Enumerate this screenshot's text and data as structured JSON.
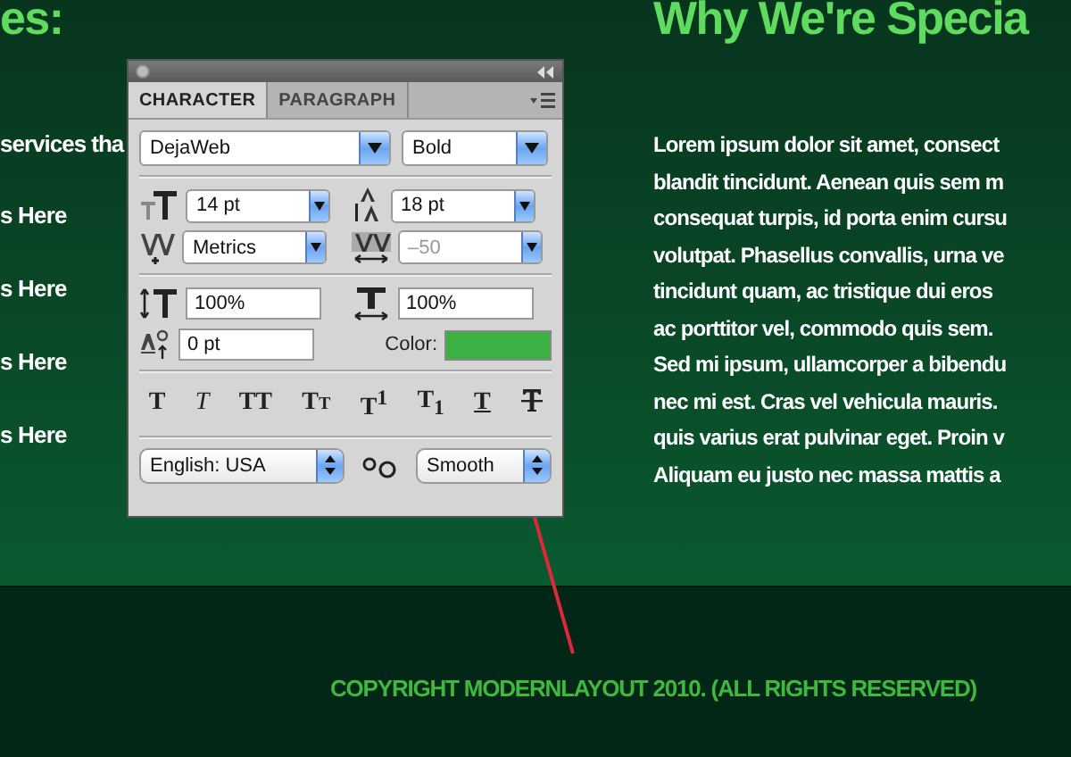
{
  "page": {
    "left_heading": "es:",
    "left_intro": "services tha",
    "left_links": [
      "s Here",
      "s Here",
      "s Here",
      "s Here"
    ],
    "right_heading": "Why We're Specia",
    "right_lines": [
      "Lorem ipsum dolor sit amet, consect",
      "blandit tincidunt. Aenean quis sem m",
      "consequat turpis, id porta enim cursu",
      "volutpat. Phasellus convallis, urna ve",
      "tincidunt quam, ac tristique dui eros",
      "ac porttitor vel, commodo quis sem.",
      "Sed mi ipsum, ullamcorper a bibendu",
      "nec mi est. Cras vel vehicula mauris.",
      "quis varius erat pulvinar eget. Proin v",
      "Aliquam eu justo nec massa mattis a"
    ]
  },
  "panel": {
    "tabs": [
      {
        "label": "CHARACTER",
        "selected": true
      },
      {
        "label": "PARAGRAPH",
        "selected": false
      }
    ],
    "font_family": "DejaWeb",
    "font_style": "Bold",
    "size": "14 pt",
    "leading": "18 pt",
    "kerning": "Metrics",
    "tracking": {
      "value": "–50",
      "disabled": true
    },
    "vertical_scale": "100%",
    "horizontal_scale": "100%",
    "baseline_shift": "0 pt",
    "color_label": "Color:",
    "color": "#3cb043",
    "style_buttons": [
      {
        "kind": "bold",
        "label": "T"
      },
      {
        "kind": "italic",
        "label": "T"
      },
      {
        "kind": "allcaps",
        "label": "TT"
      },
      {
        "kind": "smallcaps",
        "label": "Tt"
      },
      {
        "kind": "superscript",
        "label": "T$^{1}$"
      },
      {
        "kind": "subscript",
        "label": "T$_{1}$"
      },
      {
        "kind": "underline",
        "label": "T"
      },
      {
        "kind": "strikethrough"
      }
    ],
    "language": "English: USA",
    "antialias": "Smooth"
  },
  "footer": {
    "copyright": "COPYRIGHT MODERNLAYOUT 2010. (ALL RIGHTS RESERVED)"
  }
}
